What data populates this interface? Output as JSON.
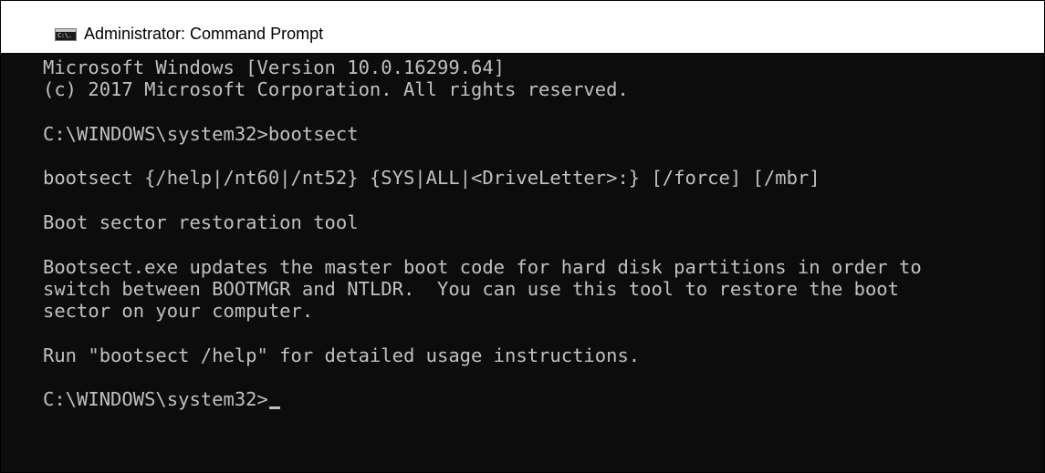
{
  "window": {
    "title": "Administrator: Command Prompt",
    "icon": "command-prompt-icon",
    "icon_label": "C:\\."
  },
  "console": {
    "lines": [
      "Microsoft Windows [Version 10.0.16299.64]",
      "(c) 2017 Microsoft Corporation. All rights reserved.",
      "",
      "C:\\WINDOWS\\system32>bootsect",
      "",
      "bootsect {/help|/nt60|/nt52} {SYS|ALL|<DriveLetter>:} [/force] [/mbr]",
      "",
      "Boot sector restoration tool",
      "",
      "Bootsect.exe updates the master boot code for hard disk partitions in order to",
      "switch between BOOTMGR and NTLDR.  You can use this tool to restore the boot",
      "sector on your computer.",
      "",
      "Run \"bootsect /help\" for detailed usage instructions.",
      "",
      "C:\\WINDOWS\\system32>"
    ]
  },
  "colors": {
    "background": "#0c0c0c",
    "text": "#c0c0c0",
    "titlebar": "#ffffff"
  }
}
